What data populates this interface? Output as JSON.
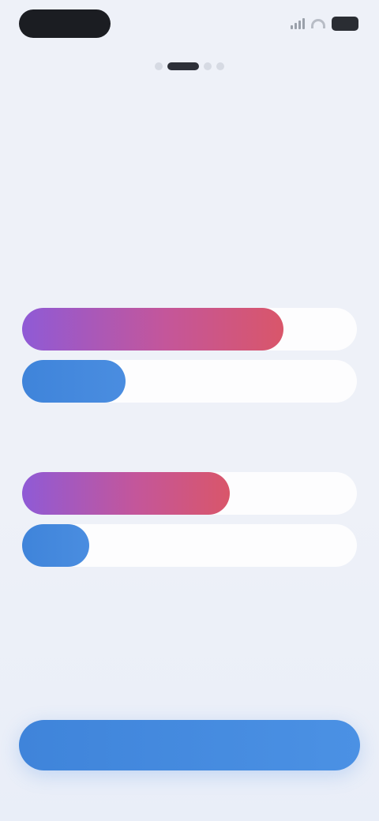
{
  "status_bar": {
    "icons": [
      "signal-icon",
      "wifi-icon",
      "battery-icon"
    ]
  },
  "onboarding": {
    "step": 2,
    "total_steps": 4
  },
  "headline": "",
  "subtitle": "",
  "comparison": {
    "groups": [
      {
        "label": "",
        "bars": [
          {
            "kind": "gradient",
            "label": "",
            "value_text": "",
            "level": 0.78
          },
          {
            "kind": "blue",
            "label": "",
            "value_text": "",
            "level": 0.31
          }
        ]
      },
      {
        "label": "",
        "bars": [
          {
            "kind": "gradient",
            "label": "",
            "value_text": "",
            "level": 0.62
          },
          {
            "kind": "blue",
            "label": "",
            "value_text": "",
            "level": 0.2
          }
        ]
      }
    ]
  },
  "colors": {
    "gradient_start": "#8f5ad6",
    "gradient_end": "#d9566a",
    "accent_blue": "#3f84da"
  },
  "continue_button": {
    "label": ""
  }
}
